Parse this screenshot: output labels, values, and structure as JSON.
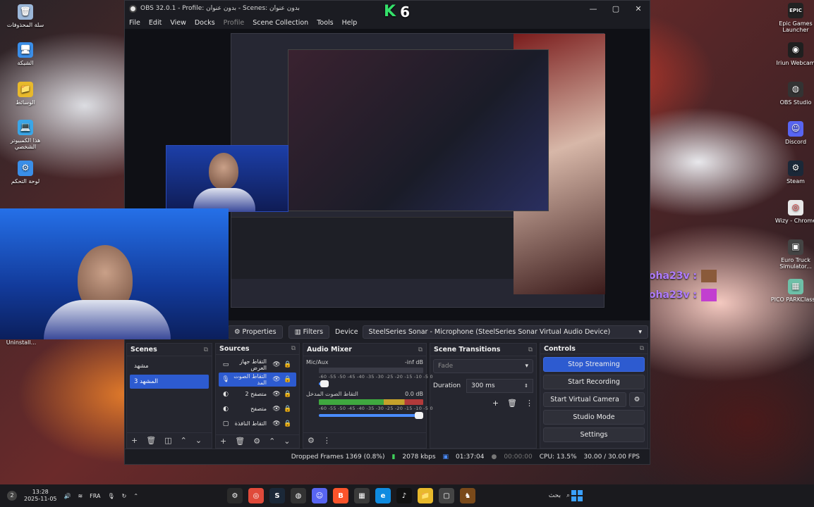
{
  "desktop": {
    "left_icons": [
      {
        "label": "سلة المحذوفات",
        "icon": "recycle-bin-icon",
        "color": "#9bb7d8",
        "glyph": "🗑"
      },
      {
        "label": "الشبكة",
        "icon": "network-icon",
        "color": "#3a8ee8",
        "glyph": "🖥"
      },
      {
        "label": "الوسائط",
        "icon": "folder-icon",
        "color": "#e8b92b",
        "glyph": "📁"
      },
      {
        "label": "هذا الكمبيوتر الشخصي",
        "icon": "this-pc-icon",
        "color": "#3aa6e8",
        "glyph": "💻"
      },
      {
        "label": "لوحة التحكم",
        "icon": "control-panel-icon",
        "color": "#3a8ee8",
        "glyph": "⚙"
      }
    ],
    "right_icons": [
      {
        "label": "Epic Games Launcher",
        "icon": "epic-games-icon",
        "color": "#222",
        "glyph": "EPIC"
      },
      {
        "label": "Iriun Webcam",
        "icon": "iriun-webcam-icon",
        "color": "#1f1f1f",
        "glyph": "◉"
      },
      {
        "label": "OBS Studio",
        "icon": "obs-icon",
        "color": "#333",
        "glyph": "◍"
      },
      {
        "label": "Discord",
        "icon": "discord-icon",
        "color": "#5865f2",
        "glyph": "☺"
      },
      {
        "label": "Steam",
        "icon": "steam-icon",
        "color": "#1b2838",
        "glyph": "⚙"
      },
      {
        "label": "Wizy - Chrome",
        "icon": "chrome-icon",
        "color": "#e8e8e8",
        "glyph": "◎"
      },
      {
        "label": "Euro Truck Simulator...",
        "icon": "truck-icon",
        "color": "#444",
        "glyph": "▣"
      },
      {
        "label": "PICO PARKClass...",
        "icon": "pico-park-icon",
        "color": "#6ec0a8",
        "glyph": "▦"
      }
    ],
    "bottom_icon_label": "Uninstall..."
  },
  "overlay": {
    "k6_text": "6",
    "chat": [
      {
        "user": "Moha23v :",
        "emote_color": "#8a5a3a"
      },
      {
        "user": "Moha23v :",
        "emote_color": "#c23fd0"
      }
    ]
  },
  "obs": {
    "title": "OBS 32.0.1 - Profile: بدون عنوان - Scenes: بدون عنوان",
    "menu": [
      "File",
      "Edit",
      "View",
      "Docks",
      "Profile",
      "Scene Collection",
      "Tools",
      "Help"
    ],
    "propbar": {
      "properties": "Properties",
      "filters": "Filters",
      "device_label": "Device",
      "device_value": "SteelSeries Sonar - Microphone (SteelSeries Sonar Virtual Audio Device)"
    },
    "scenes": {
      "title": "Scenes",
      "items": [
        "مشهد",
        "المشهد 3"
      ],
      "active_index": 1
    },
    "sources": {
      "title": "Sources",
      "items": [
        {
          "name": "التقاط جهاز العرض",
          "icon": "display-capture-icon",
          "glyph": "▭"
        },
        {
          "name": "التقاط الصوت المد",
          "icon": "mic-icon",
          "glyph": "🎙"
        },
        {
          "name": "متصفح 2",
          "icon": "browser-icon",
          "glyph": "◐"
        },
        {
          "name": "متصفح",
          "icon": "browser-icon",
          "glyph": "◐"
        },
        {
          "name": "التقاط النافذة",
          "icon": "window-capture-icon",
          "glyph": "▢"
        }
      ]
    },
    "mixer": {
      "title": "Audio Mixer",
      "channels": [
        {
          "name": "Mic/Aux",
          "level": "-inf dB"
        },
        {
          "name": "التقاط الصوت المدخل",
          "level": "0.0 dB"
        }
      ],
      "scale": "-60 -55 -50 -45 -40 -35 -30 -25 -20 -15 -10 -5 0"
    },
    "transitions": {
      "title": "Scene Transitions",
      "selected": "Fade",
      "duration_label": "Duration",
      "duration_value": "300 ms"
    },
    "controls": {
      "title": "Controls",
      "stop_streaming": "Stop Streaming",
      "start_recording": "Start Recording",
      "start_virtual_camera": "Start Virtual Camera",
      "studio_mode": "Studio Mode",
      "settings": "Settings"
    },
    "status": {
      "dropped": "Dropped Frames 1369 (0.8%)",
      "bitrate": "2078 kbps",
      "stream_time": "01:37:04",
      "rec_time": "00:00:00",
      "cpu": "CPU: 13.5%",
      "fps": "30.00 / 30.00 FPS"
    }
  },
  "taskbar": {
    "notification_count": "2",
    "time": "13:28",
    "date": "2025-11-05",
    "lang": "FRA",
    "search_text": "بحث",
    "apps": [
      {
        "icon": "settings-icon",
        "color": "#2b2b2b",
        "glyph": "⚙"
      },
      {
        "icon": "chrome-icon",
        "color": "#e04a3a",
        "glyph": "◎"
      },
      {
        "icon": "steam-icon",
        "color": "#1b2838",
        "glyph": "S"
      },
      {
        "icon": "obs-icon",
        "color": "#333",
        "glyph": "◍"
      },
      {
        "icon": "discord-icon",
        "color": "#5865f2",
        "glyph": "☺"
      },
      {
        "icon": "brave-icon",
        "color": "#fb542b",
        "glyph": "B"
      },
      {
        "icon": "calendar-icon",
        "color": "#3a3a3a",
        "glyph": "▦"
      },
      {
        "icon": "edge-icon",
        "color": "#0f8be0",
        "glyph": "e"
      },
      {
        "icon": "tiktok-icon",
        "color": "#111",
        "glyph": "♪"
      },
      {
        "icon": "file-explorer-icon",
        "color": "#e8b92b",
        "glyph": "📁"
      },
      {
        "icon": "window-icon",
        "color": "#444",
        "glyph": "▢"
      },
      {
        "icon": "game-icon",
        "color": "#7a4a1a",
        "glyph": "♞"
      }
    ]
  }
}
